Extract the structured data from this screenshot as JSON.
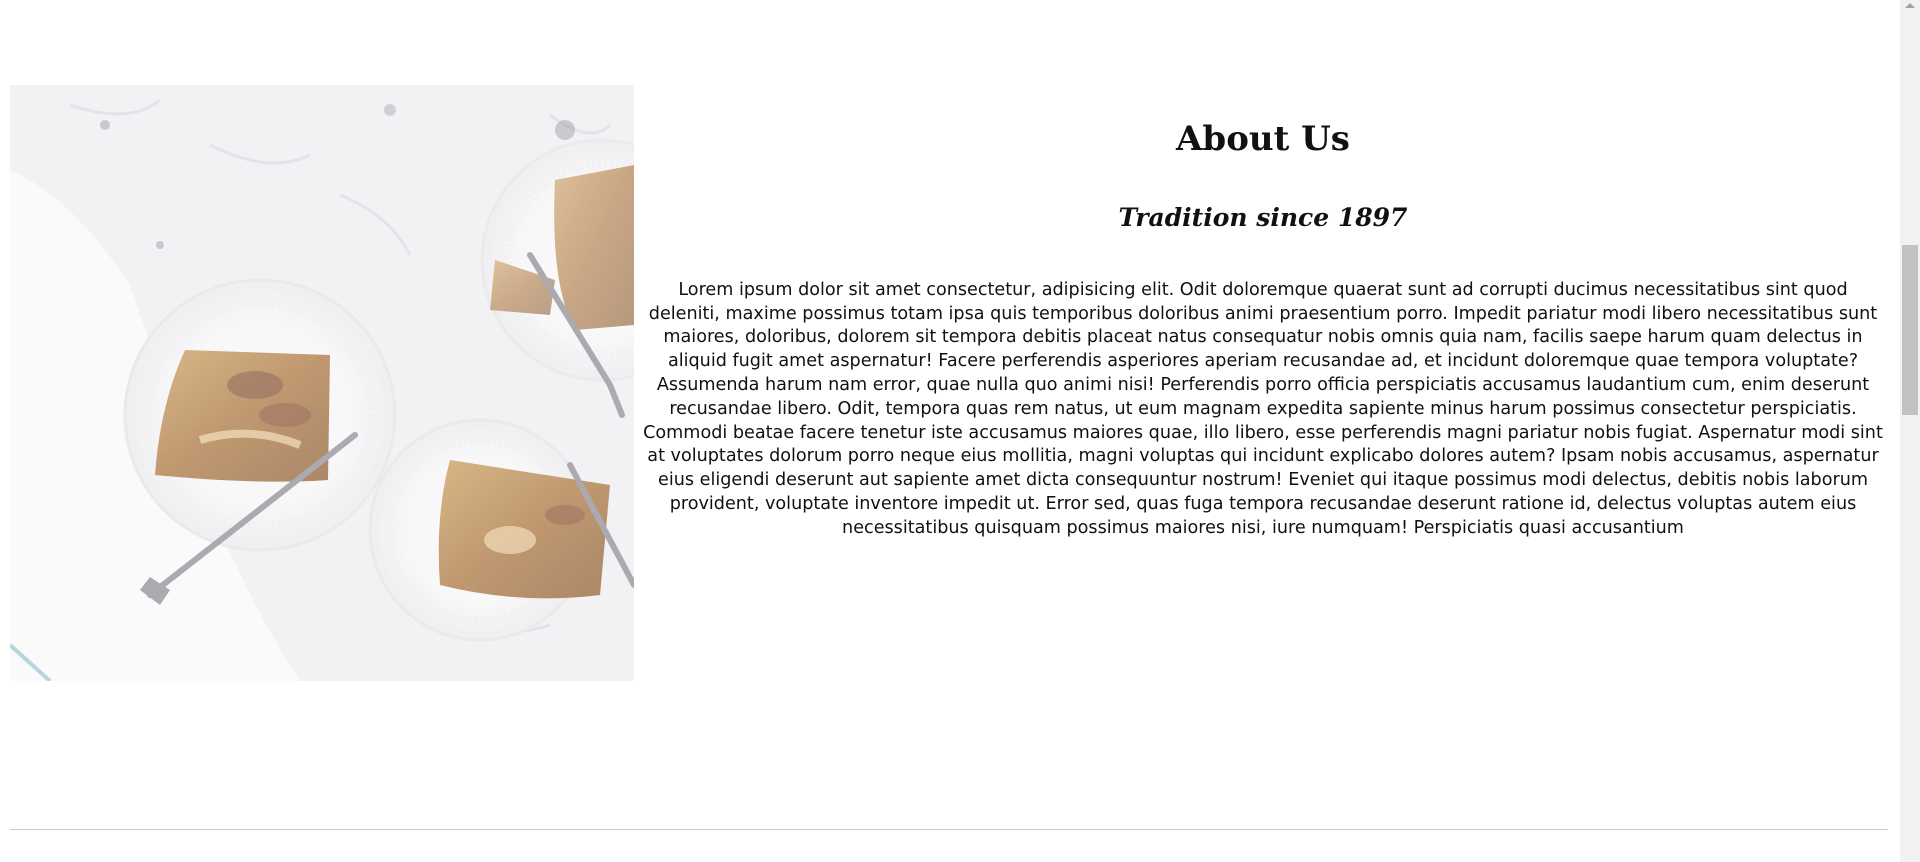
{
  "about": {
    "title": "About Us",
    "subtitle": "Tradition since 1897",
    "body": "Lorem ipsum dolor sit amet consectetur, adipisicing elit. Odit doloremque quaerat sunt ad corrupti ducimus necessitatibus sint quod deleniti, maxime possimus totam ipsa quis temporibus doloribus animi praesentium porro. Impedit pariatur modi libero necessitatibus sunt maiores, doloribus, dolorem sit tempora debitis placeat natus consequatur nobis omnis quia nam, facilis saepe harum quam delectus in aliquid fugit amet aspernatur! Facere perferendis asperiores aperiam recusandae ad, et incidunt doloremque quae tempora voluptate? Assumenda harum nam error, quae nulla quo animi nisi! Perferendis porro officia perspiciatis accusamus laudantium cum, enim deserunt recusandae libero. Odit, tempora quas rem natus, ut eum magnam expedita sapiente minus harum possimus consectetur perspiciatis. Commodi beatae facere tenetur iste accusamus maiores quae, illo libero, esse perferendis magni pariatur nobis fugiat. Aspernatur modi sint at voluptates dolorum porro neque eius mollitia, magni voluptas qui incidunt explicabo dolores autem? Ipsam nobis accusamus, aspernatur eius eligendi deserunt aut sapiente amet dicta consequuntur nostrum! Eveniet qui itaque possimus modi delectus, debitis nobis laborum provident, voluptate inventore impedit ut. Error sed, quas fuga tempora recusandae deserunt ratione id, delectus voluptas autem eius necessitatibus quisquam possimus maiores nisi, iure numquam! Perspiciatis quasi accusantium"
  },
  "image": {
    "subject": "apple galette slices on white plates with forks on marble table"
  },
  "colors": {
    "background": "#ffffff",
    "text": "#111111",
    "divider": "#c8c8c8",
    "scroll_track": "#f1f1f1",
    "scroll_thumb": "#c1c1c1"
  }
}
